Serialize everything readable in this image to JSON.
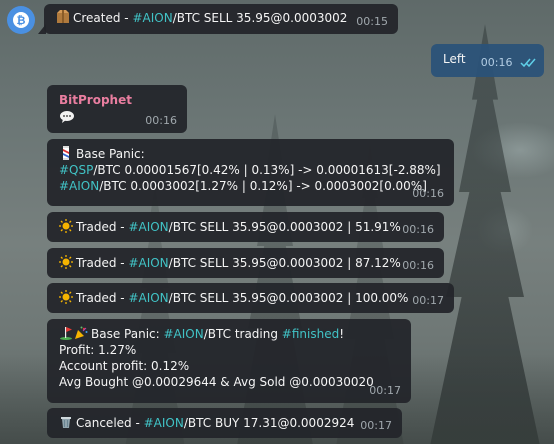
{
  "messages": {
    "m1": {
      "text_pre": "Created - ",
      "tag": "#AION",
      "text_post": "/BTC SELL 35.95@0.0003002",
      "time": "00:15",
      "icon": "package-icon"
    },
    "m2": {
      "text": "Left",
      "time": "00:16",
      "status": "read-double-check-icon"
    },
    "m3": {
      "sender": "BitProphet",
      "time": "00:16",
      "icon": "speech-bubble-icon"
    },
    "m4": {
      "title": "Base Panic:",
      "line1_tag": "#QSP",
      "line1_rest": "/BTC 0.00001567[0.42% | 0.13%] -> 0.00001613[-2.88%]",
      "line2_tag": "#AION",
      "line2_rest": "/BTC 0.0003002[1.27% | 0.12%] -> 0.0003002[0.00%]",
      "time": "00:16",
      "icon": "barber-pole-icon"
    },
    "m5": {
      "text_pre": "Traded - ",
      "tag": "#AION",
      "text_post": "/BTC SELL 35.95@0.0003002 | 51.91%",
      "time": "00:16",
      "icon": "sun-icon"
    },
    "m6": {
      "text_pre": "Traded - ",
      "tag": "#AION",
      "text_post": "/BTC SELL 35.95@0.0003002 | 87.12%",
      "time": "00:16",
      "icon": "sun-icon"
    },
    "m7": {
      "text_pre": "Traded - ",
      "tag": "#AION",
      "text_post": "/BTC SELL 35.95@0.0003002 | 100.00%",
      "time": "00:17",
      "icon": "sun-icon"
    },
    "m8": {
      "title_pre": "Base Panic: ",
      "tag": "#AION",
      "title_mid": "/BTC trading ",
      "tag2": "#finished",
      "title_end": "!",
      "profit": "Profit: 1.27%",
      "account_profit": "Account profit: 0.12%",
      "avg": "Avg Bought @0.00029644 & Avg Sold @0.00030020",
      "time": "00:17",
      "icons": [
        "golf-flag-icon",
        "party-popper-icon"
      ]
    },
    "m9": {
      "text_pre": "Canceled - ",
      "tag": "#AION",
      "text_post": "/BTC BUY 17.31@0.0002924",
      "time": "00:17",
      "icon": "wastebasket-icon"
    }
  },
  "colors": {
    "incoming_bubble": "#23252a",
    "outgoing_bubble": "#2b5278",
    "hashtag": "#41c3c6",
    "sender": "#e97ea0",
    "avatar": "#4a90e2"
  }
}
